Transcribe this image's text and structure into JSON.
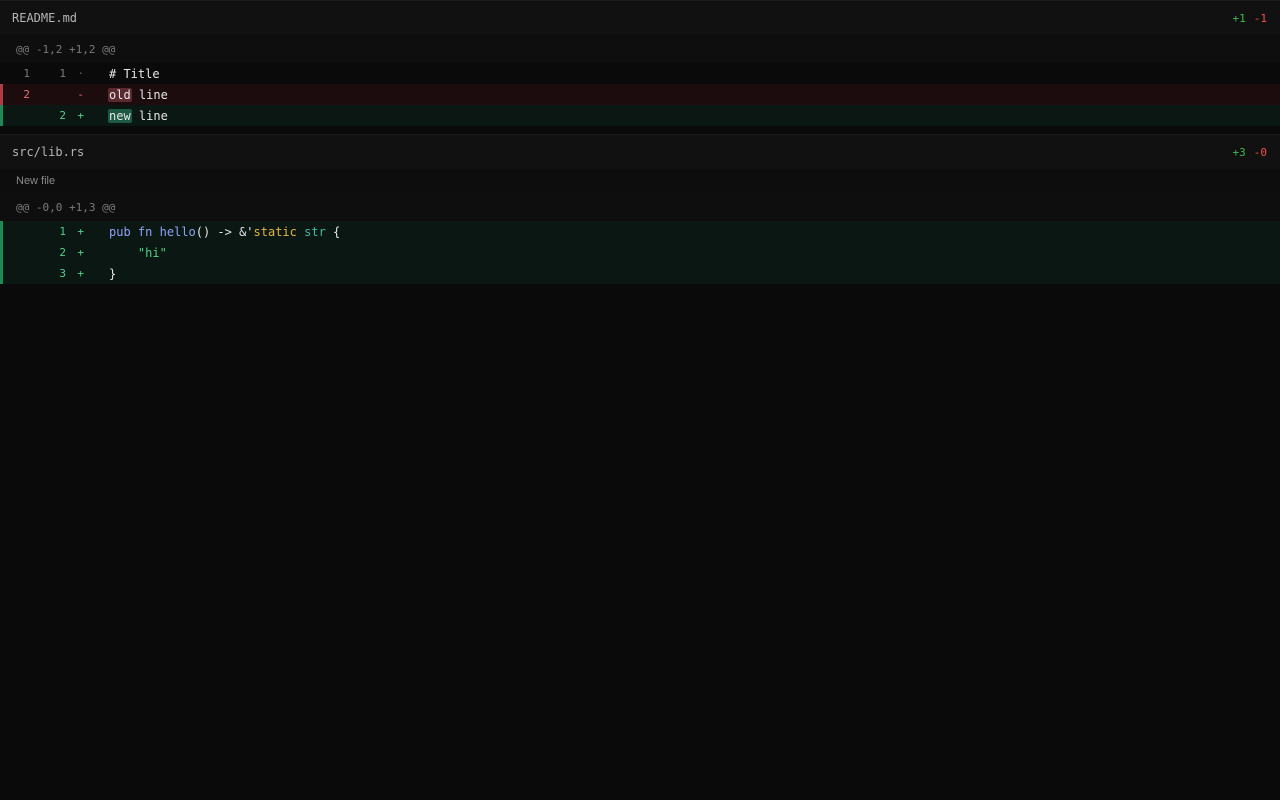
{
  "files": [
    {
      "name": "README.md",
      "additions": "+1",
      "deletions": "-1",
      "hunk": "@@ -1,2 +1,2 @@",
      "lines": {
        "l1": {
          "old": "1",
          "new": "1",
          "marker": "·",
          "text": "# Title"
        },
        "l2": {
          "old": "2",
          "new": "",
          "marker": "-",
          "highlight": "old",
          "rest": " line"
        },
        "l3": {
          "old": "",
          "new": "2",
          "marker": "+",
          "highlight": "new",
          "rest": " line"
        }
      }
    },
    {
      "name": "src/lib.rs",
      "additions": "+3",
      "deletions": "-0",
      "note": "New file",
      "hunk": "@@ -0,0 +1,3 @@",
      "lines": {
        "l1": {
          "new": "1",
          "marker": "+",
          "tokens": {
            "t1": "pub",
            "t2": " ",
            "t3": "fn",
            "t4": " ",
            "t5": "hello",
            "t6": "() -> &'",
            "t7": "static",
            "t8": " ",
            "t9": "str",
            "t10": " {"
          }
        },
        "l2": {
          "new": "2",
          "marker": "+",
          "text": "    \"hi\""
        },
        "l3": {
          "new": "3",
          "marker": "+",
          "text": "}"
        }
      }
    }
  ],
  "colors": {
    "background": "#0a0a0a",
    "added": "#3fb950",
    "deleted": "#f85149",
    "keyword": "#8ea2f5",
    "lifetime": "#e3b341",
    "type": "#3fb9a0"
  }
}
